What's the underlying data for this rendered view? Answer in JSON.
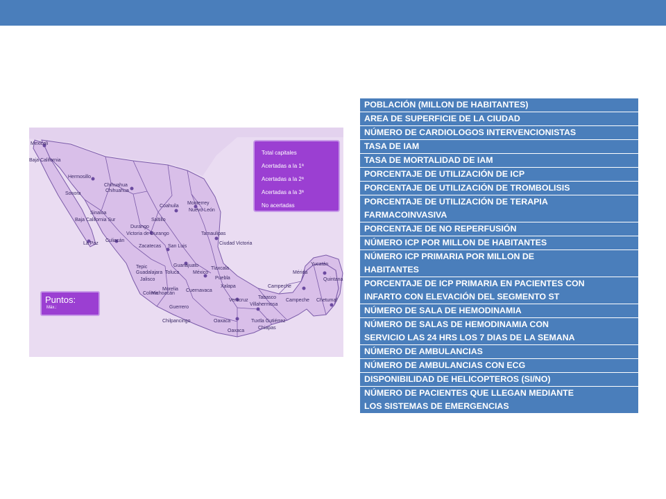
{
  "map": {
    "legend": {
      "items": [
        "Total capitales",
        "Acertadas a la 1ª",
        "Acertadas a la 2ª",
        "Acertadas a la 3ª",
        "No acertadas"
      ]
    },
    "score": {
      "title": "Puntos:",
      "sub": "Máx.:"
    },
    "labels": [
      "Mexicali",
      "Baja California",
      "Hermosillo",
      "Sonora",
      "Chihuahua",
      "Chihuahua",
      "Coahuila",
      "Saltillo",
      "Monterrey",
      "Nuevo León",
      "Sinaloa",
      "Culiacán",
      "Baja California Sur",
      "La Paz",
      "Durango",
      "Victoria de Durango",
      "Zacatecas",
      "San Luis",
      "Ciudad Victoria",
      "Tepic",
      "Guadalajara",
      "Jalisco",
      "Colima",
      "Michoacán",
      "Morelia",
      "Guanajuato",
      "México",
      "Tlaxcala",
      "Puebla",
      "Toluca",
      "Cuernavaca",
      "Xalapa",
      "Veracruz",
      "Guerrero",
      "Chilpancingo",
      "Oaxaca",
      "Oaxaca",
      "Tuxtla Gutiérrez",
      "Chiapas",
      "Tabasco",
      "Villahermosa",
      "Campeche",
      "Campeche",
      "Mérida",
      "Yucatán",
      "Quintana Roo",
      "Chetumal",
      "Tamaulipas"
    ]
  },
  "metrics": [
    [
      "POBLACIÓN (MILLON DE HABITANTES)"
    ],
    [
      "AREA DE SUPERFICIE DE LA CIUDAD"
    ],
    [
      "NÚMERO DE CARDIOLOGOS INTERVENCIONISTAS"
    ],
    [
      "TASA DE IAM"
    ],
    [
      "TASA DE MORTALIDAD DE IAM"
    ],
    [
      "PORCENTAJE DE UTILIZACIÓN DE ICP"
    ],
    [
      "PORCENTAJE DE UTILIZACIÓN DE TROMBOLISIS"
    ],
    [
      "PORCENTAJE DE UTILIZACIÓN DE TERAPIA",
      "FARMACOINVASIVA"
    ],
    [
      "PORCENTAJE DE NO REPERFUSIÓN"
    ],
    [
      "NÚMERO ICP POR MILLON DE HABITANTES"
    ],
    [
      "NÚMERO ICP PRIMARIA POR MILLON DE",
      "HABITANTES"
    ],
    [
      "PORCENTAJE DE ICP PRIMARIA EN PACIENTES CON",
      "INFARTO CON ELEVACIÓN DEL SEGMENTO ST"
    ],
    [
      "NÚMERO DE SALA DE HEMODINAMIA"
    ],
    [
      "NÚMERO DE SALAS DE HEMODINAMIA CON",
      "SERVICIO LAS 24 HRS LOS 7 DIAS DE LA SEMANA"
    ],
    [
      "NÚMERO DE AMBULANCIAS"
    ],
    [
      "NÚMERO DE AMBULANCIAS CON ECG"
    ],
    [
      "DISPONIBILIDAD DE HELICOPTEROS (SI/NO)"
    ],
    [
      "NÚMERO DE PACIENTES QUE LLEGAN MEDIANTE",
      "LOS SISTEMAS DE EMERGENCIAS"
    ]
  ]
}
